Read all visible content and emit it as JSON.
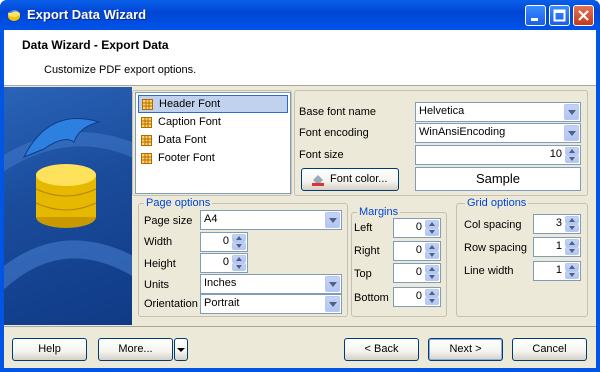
{
  "window": {
    "title": "Export Data Wizard"
  },
  "header": {
    "title": "Data Wizard - Export Data",
    "subtitle": "Customize PDF export options."
  },
  "font_list": {
    "items": [
      {
        "label": "Header Font",
        "selected": true
      },
      {
        "label": "Caption Font",
        "selected": false
      },
      {
        "label": "Data Font",
        "selected": false
      },
      {
        "label": "Footer Font",
        "selected": false
      }
    ]
  },
  "font_props": {
    "base_font_label": "Base font name",
    "base_font_value": "Helvetica",
    "encoding_label": "Font encoding",
    "encoding_value": "WinAnsiEncoding",
    "size_label": "Font size",
    "size_value": "10",
    "color_button": "Font color...",
    "sample": "Sample"
  },
  "page_options": {
    "title": "Page options",
    "page_size_label": "Page size",
    "page_size_value": "A4",
    "width_label": "Width",
    "width_value": "0",
    "height_label": "Height",
    "height_value": "0",
    "units_label": "Units",
    "units_value": "Inches",
    "orientation_label": "Orientation",
    "orientation_value": "Portrait"
  },
  "margins": {
    "title": "Margins",
    "left_label": "Left",
    "left_value": "0",
    "right_label": "Right",
    "right_value": "0",
    "top_label": "Top",
    "top_value": "0",
    "bottom_label": "Bottom",
    "bottom_value": "0"
  },
  "grid_options": {
    "title": "Grid options",
    "col_label": "Col spacing",
    "col_value": "3",
    "row_label": "Row spacing",
    "row_value": "1",
    "line_label": "Line width",
    "line_value": "1"
  },
  "buttons": {
    "help": "Help",
    "more": "More...",
    "back": "< Back",
    "next": "Next >",
    "cancel": "Cancel"
  },
  "colors": {
    "title_bar": "#0054e3",
    "accent_label": "#0046d5",
    "dialog_bg": "#ece9d8"
  },
  "icons": {
    "title": "dolphin-app-icon",
    "list_item": "grid-font-icon",
    "color_button": "paint-bucket-icon"
  }
}
